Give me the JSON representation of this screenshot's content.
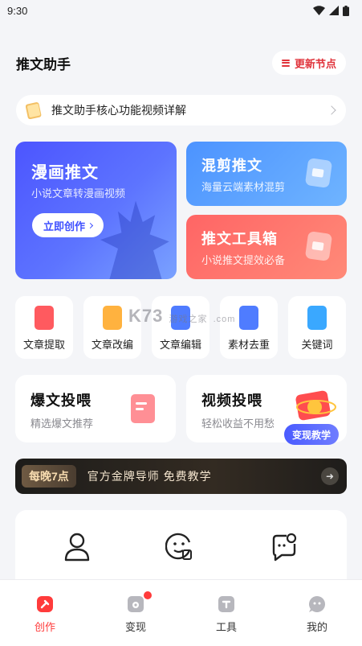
{
  "status": {
    "time": "9:30"
  },
  "header": {
    "title": "推文助手",
    "update_label": "更新节点"
  },
  "notice": {
    "text": "推文助手核心功能视频详解"
  },
  "cards": {
    "comic": {
      "title": "漫画推文",
      "subtitle": "小说文章转漫画视频",
      "button": "立即创作"
    },
    "mix": {
      "title": "混剪推文",
      "subtitle": "海量云端素材混剪"
    },
    "tools": {
      "title": "推文工具箱",
      "subtitle": "小说推文提效必备"
    }
  },
  "tools": [
    {
      "label": "文章提取",
      "icon": "doc-extract-icon",
      "color": "#ff5a5f"
    },
    {
      "label": "文章改编",
      "icon": "doc-adapt-icon",
      "color": "#ffb23f"
    },
    {
      "label": "文章编辑",
      "icon": "doc-edit-icon",
      "color": "#4f7cff"
    },
    {
      "label": "素材去重",
      "icon": "dedupe-icon",
      "color": "#4f7cff"
    },
    {
      "label": "关键词",
      "icon": "keyword-icon",
      "color": "#3aa8ff"
    }
  ],
  "feed": {
    "hot": {
      "title": "爆文投喂",
      "subtitle": "精选爆文推荐"
    },
    "video": {
      "title": "视频投喂",
      "subtitle": "轻松收益不用愁",
      "badge": "变现教学"
    }
  },
  "promo": {
    "badge": "每晚7点",
    "text": "官方金牌导师  免费教学"
  },
  "watermark": {
    "brand": "K73",
    "sub": "游戏之家",
    "domain": ".com"
  },
  "tabs": [
    {
      "label": "创作",
      "icon": "create-icon",
      "active": true
    },
    {
      "label": "变现",
      "icon": "monetize-icon",
      "active": false
    },
    {
      "label": "工具",
      "icon": "tools-icon",
      "active": false
    },
    {
      "label": "我的",
      "icon": "profile-icon",
      "active": false
    }
  ]
}
